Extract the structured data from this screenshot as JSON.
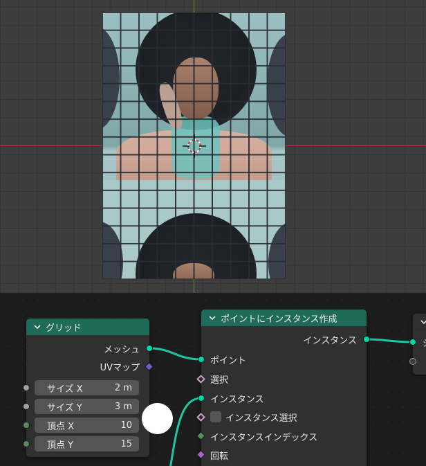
{
  "viewport": {
    "plane_icon": "image-texture-plane",
    "cursor_icon": "3d-cursor-icon",
    "axis_colors": {
      "x": "#9b3d48",
      "y": "#6f8f2c"
    }
  },
  "node_editor": {
    "grid_node": {
      "title": "グリッド",
      "outputs": {
        "mesh": "メッシュ",
        "uv_map": "UVマップ"
      },
      "fields": [
        {
          "label": "サイズ X",
          "value": "2 m"
        },
        {
          "label": "サイズ Y",
          "value": "3 m"
        },
        {
          "label": "頂点 X",
          "value": "10"
        },
        {
          "label": "頂点 Y",
          "value": "15"
        }
      ]
    },
    "instance_node": {
      "title": "ポイントにインスタンス作成",
      "output": "インスタンス",
      "inputs": {
        "points": "ポイント",
        "selection": "選択",
        "instance": "インスタンス",
        "pick_instance": "インスタンス選択",
        "instance_index": "インスタンスインデックス",
        "rotation": "回転"
      }
    },
    "right_node": {
      "label_fragment": "ジ"
    },
    "header_color": "#1f6b5a",
    "link_color": "#1fc6a0"
  }
}
